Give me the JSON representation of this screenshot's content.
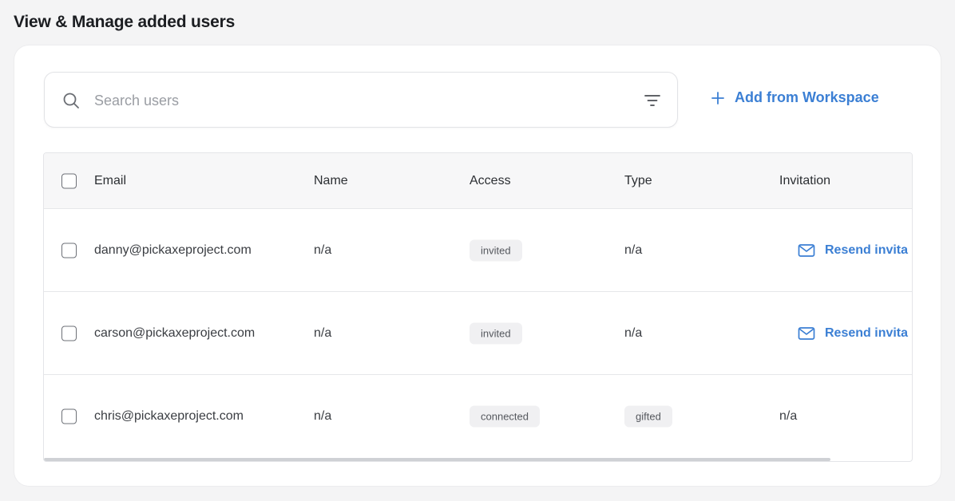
{
  "page": {
    "title": "View & Manage added users"
  },
  "search": {
    "placeholder": "Search users"
  },
  "actions": {
    "add_from_workspace": "Add from Workspace"
  },
  "table": {
    "columns": [
      "Email",
      "Name",
      "Access",
      "Type",
      "Invitation"
    ],
    "rows": [
      {
        "email": "danny@pickaxeproject.com",
        "name": "n/a",
        "access": "invited",
        "type": "n/a",
        "invitation": "Resend invita"
      },
      {
        "email": "carson@pickaxeproject.com",
        "name": "n/a",
        "access": "invited",
        "type": "n/a",
        "invitation": "Resend invita"
      },
      {
        "email": "chris@pickaxeproject.com",
        "name": "n/a",
        "access": "connected",
        "type": "gifted",
        "invitation": "n/a"
      }
    ]
  },
  "colors": {
    "accent": "#3b7fd4",
    "badge_bg": "#f0f0f2",
    "background": "#f4f4f5"
  },
  "icons": [
    "search-icon",
    "filter-icon",
    "plus-icon",
    "mail-icon",
    "checkbox"
  ]
}
